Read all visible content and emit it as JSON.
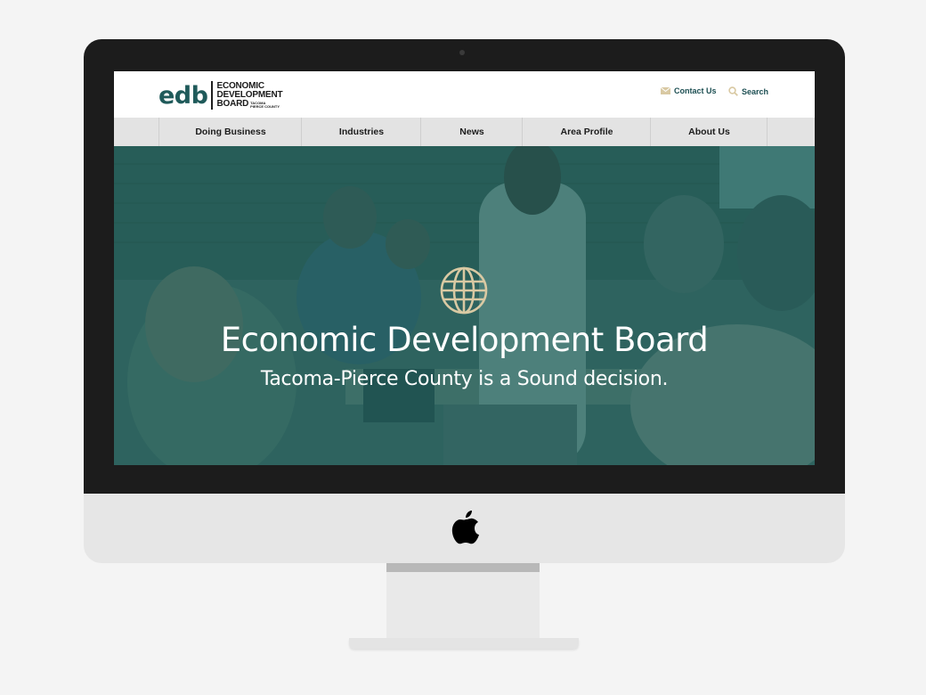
{
  "logo": {
    "mark": "edb",
    "line1": "ECONOMIC",
    "line2": "DEVELOPMENT",
    "line3": "BOARD",
    "sub1": "TACOMA",
    "sub2": "PIERCE COUNTY"
  },
  "utility": {
    "contact_label": "Contact Us",
    "contact_icon": "envelope-icon",
    "search_label": "Search",
    "search_icon": "magnifier-icon"
  },
  "nav": {
    "items": [
      "Doing Business",
      "Industries",
      "News",
      "Area Profile",
      "About Us"
    ]
  },
  "hero": {
    "icon": "globe-icon",
    "title": "Economic Development Board",
    "subtitle": "Tacoma-Pierce County is a Sound decision."
  },
  "colors": {
    "brand_teal": "#1f5a5a",
    "overlay_teal": "#186a68",
    "accent_gold": "#d9c9a3",
    "nav_bg": "#e3e3e3"
  },
  "device": {
    "logo_icon": "apple-logo-icon"
  }
}
